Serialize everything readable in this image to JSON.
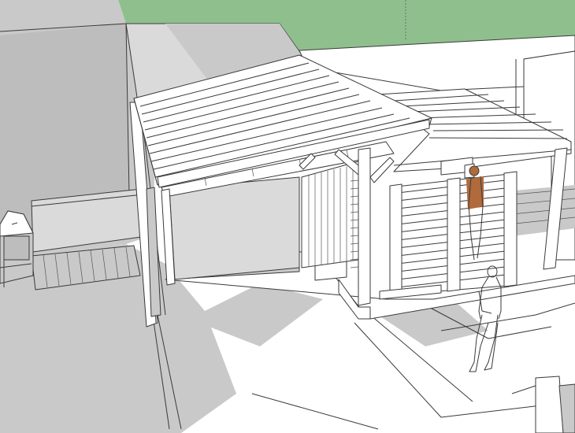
{
  "viewport": {
    "kind": "3d-model-viewport",
    "scene": "pergola-with-louvered-screens",
    "colors": {
      "sky": "#8fbf8d",
      "background": "#ffffff",
      "shadow": "#c9c9c9",
      "deep_shadow": "#bdbdbd",
      "wall_shaded": "#dadada",
      "edge": "#3a3a3a",
      "figure_hair": "#b06a3b"
    },
    "objects": [
      "ground-plane",
      "sky-area",
      "boundary-wall",
      "gable-roof",
      "flat-pergola",
      "support-post",
      "slatted-wall",
      "louvered-screen",
      "wooden-deck",
      "doghouse",
      "concrete-step",
      "person-silhouette",
      "person-figure-orange"
    ]
  }
}
